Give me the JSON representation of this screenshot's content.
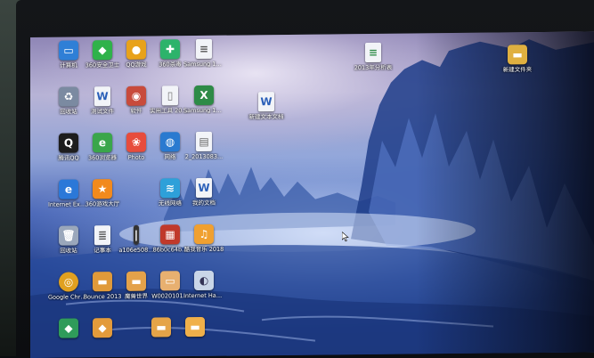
{
  "desktop": {
    "icons": [
      {
        "label": "计算机",
        "icon": "computer-icon",
        "color": "#2f7fd6"
      },
      {
        "label": "360安全卫士",
        "icon": "shield-icon",
        "color": "#2fb24a"
      },
      {
        "label": "QQ游戏",
        "icon": "qq-game-icon",
        "color": "#e8a21b"
      },
      {
        "label": "360杀毒",
        "icon": "antivirus-icon",
        "color": "#2db36b"
      },
      {
        "label": "Samsung 19300 Sa...",
        "icon": "document-icon",
        "color": "#d7dce6"
      },
      {
        "label": "回收站",
        "icon": "recycle-bin-icon",
        "color": "#7b8aa1"
      },
      {
        "label": "测试文件",
        "icon": "word-doc-icon",
        "color": "#2a5fb8"
      },
      {
        "label": "软件",
        "icon": "app-icon",
        "color": "#c84b3b"
      },
      {
        "label": "实用工具 20130...",
        "icon": "file-icon",
        "color": "#e6e9ef"
      },
      {
        "label": "Samsung 19300 Ga...",
        "icon": "excel-icon",
        "color": "#2e8b47"
      },
      {
        "label": "腾讯QQ",
        "icon": "qq-icon",
        "color": "#1d1d1d"
      },
      {
        "label": "360浏览器",
        "icon": "browser-icon",
        "color": "#3aa64a"
      },
      {
        "label": "Photo",
        "icon": "image-icon",
        "color": "#e74c3c"
      },
      {
        "label": "网络",
        "icon": "network-icon",
        "color": "#2a7ad0"
      },
      {
        "label": "2_2013083...",
        "icon": "file-icon",
        "color": "#dfe3ea"
      },
      {
        "label": "Internet Explorer",
        "icon": "ie-icon",
        "color": "#2b78d8"
      },
      {
        "label": "360游戏大厅",
        "icon": "game-hall-icon",
        "color": "#f28a1d"
      },
      {
        "label": "无线网络",
        "icon": "wifi-icon",
        "color": "#2ea0d9"
      },
      {
        "label": "我的文档",
        "icon": "word-doc-icon",
        "color": "#2a5fb8"
      },
      {
        "label": "回收站",
        "icon": "trash-icon",
        "color": "#9aa7bb"
      },
      {
        "label": "记事本",
        "icon": "notepad-icon",
        "color": "#e9edf3"
      },
      {
        "label": "a106e508...",
        "icon": "file-icon",
        "color": "#333333"
      },
      {
        "label": "86b0c64b...",
        "icon": "image-icon",
        "color": "#c0392b"
      },
      {
        "label": "酷我音乐 2018",
        "icon": "music-icon",
        "color": "#f0a030"
      },
      {
        "label": "Google Chrome",
        "icon": "chrome-icon",
        "color": "#e0a020"
      },
      {
        "label": "Bounce 2013",
        "icon": "folder-icon",
        "color": "#e09a3a"
      },
      {
        "label": "魔兽世界",
        "icon": "folder-icon",
        "color": "#e4a24a"
      },
      {
        "label": "W0020101...",
        "icon": "file-icon",
        "color": "#e8b070"
      },
      {
        "label": "Internet Haozi23",
        "icon": "internet-icon",
        "color": "#c9d6e8"
      },
      {
        "label": "",
        "icon": "app-icon",
        "color": "#2f9b5a"
      },
      {
        "label": "",
        "icon": "app-icon",
        "color": "#e39b3b"
      },
      {
        "label": "",
        "icon": "folder-icon",
        "color": "#e5a448"
      },
      {
        "label": "",
        "icon": "folder-icon",
        "color": "#f0b04a"
      },
      {
        "label": "2013年分析表",
        "icon": "excel-icon",
        "color": "#e7e9ee"
      },
      {
        "label": "新建文本文档",
        "icon": "word-doc-icon",
        "color": "#2a5fb8"
      },
      {
        "label": "新建文件夹",
        "icon": "folder-icon",
        "color": "#e0b040"
      }
    ]
  },
  "colors": {
    "bezel": "#0c0d10",
    "sky_top": "#8f86b6",
    "water": "#23418f",
    "label_text": "#ffffff"
  }
}
